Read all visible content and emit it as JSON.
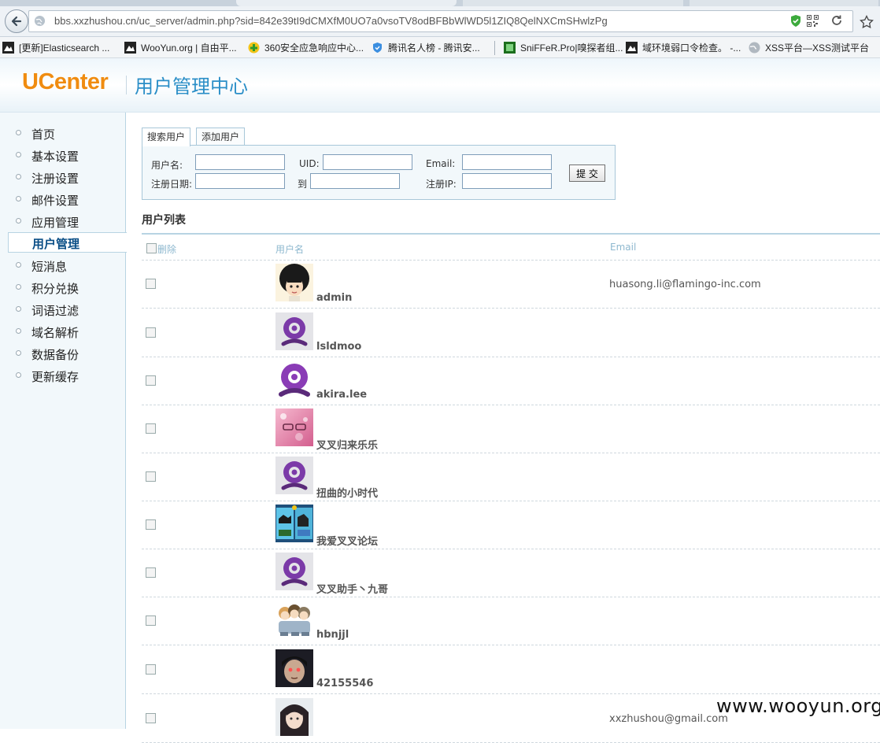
{
  "browser": {
    "url": "bbs.xxzhushou.cn/uc_server/admin.php?sid=842e39tI9dCMXfM0UO7a0vsoTV8odBFBbWlWD5l1ZIQ8QelNXCmSHwlzPg",
    "bookmarks": [
      {
        "label": "[更新]Elasticsearch ...",
        "icon": "wooyun-icon"
      },
      {
        "label": "WooYun.org | 自由平...",
        "icon": "wooyun-icon"
      },
      {
        "label": "360安全应急响应中心...",
        "icon": "360-icon"
      },
      {
        "label": "腾讯名人榜 - 腾讯安...",
        "icon": "shield-icon"
      },
      {
        "label": "SniFFeR.Pro|嗅探者组...",
        "icon": "sniffer-icon"
      },
      {
        "label": "域环境弱口令检查。 -...",
        "icon": "wooyun-icon"
      },
      {
        "label": "XSS平台—XSS测试平台",
        "icon": "globe-icon"
      }
    ]
  },
  "header": {
    "logo": "UCenter",
    "title": "用户管理中心"
  },
  "sidebar": {
    "items": [
      {
        "label": "首页"
      },
      {
        "label": "基本设置"
      },
      {
        "label": "注册设置"
      },
      {
        "label": "邮件设置"
      },
      {
        "label": "应用管理"
      },
      {
        "label": "用户管理",
        "active": true
      },
      {
        "label": "短消息"
      },
      {
        "label": "积分兑换"
      },
      {
        "label": "词语过滤"
      },
      {
        "label": "域名解析"
      },
      {
        "label": "数据备份"
      },
      {
        "label": "更新缓存"
      }
    ]
  },
  "tabs": {
    "search": "搜索用户",
    "add": "添加用户"
  },
  "search": {
    "username_label": "用户名:",
    "uid_label": "UID:",
    "email_label": "Email:",
    "regdate_label": "注册日期:",
    "to_label": "到",
    "regip_label": "注册IP:",
    "submit": "提 交"
  },
  "list": {
    "title": "用户列表",
    "col_delete": "删除",
    "col_username": "用户名",
    "col_email": "Email",
    "rows": [
      {
        "username": "admin",
        "email": "huasong.li@flamingo-inc.com",
        "avatar": "afro-cartoon"
      },
      {
        "username": "lsldmoo",
        "email": "",
        "avatar": "default-grey"
      },
      {
        "username": "akira.lee",
        "email": "",
        "avatar": "default-purple"
      },
      {
        "username": "叉叉归来乐乐",
        "email": "",
        "avatar": "pink-photo"
      },
      {
        "username": "扭曲的小时代",
        "email": "",
        "avatar": "default-grey"
      },
      {
        "username": "我爱叉叉论坛",
        "email": "",
        "avatar": "game-screens"
      },
      {
        "username": "叉叉助手丶九哥",
        "email": "",
        "avatar": "default-grey"
      },
      {
        "username": "hbnjjl",
        "email": "",
        "avatar": "anime-group"
      },
      {
        "username": "42155546",
        "email": "",
        "avatar": "dark-face"
      },
      {
        "username": "",
        "email": "xxzhushou@gmail.com",
        "avatar": "girl-photo"
      }
    ]
  },
  "watermark": "www.wooyun.org"
}
